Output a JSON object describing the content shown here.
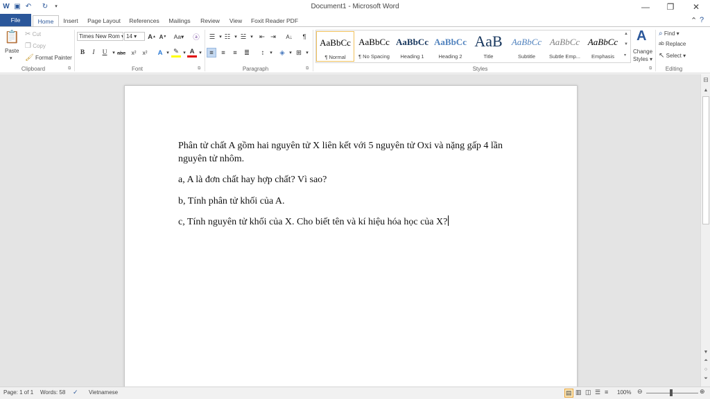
{
  "window": {
    "title": "Document1 - Microsoft Word",
    "minimize": "—",
    "restore": "❐",
    "close": "✕"
  },
  "tabs": [
    {
      "label": "File"
    },
    {
      "label": "Home"
    },
    {
      "label": "Insert"
    },
    {
      "label": "Page Layout"
    },
    {
      "label": "References"
    },
    {
      "label": "Mailings"
    },
    {
      "label": "Review"
    },
    {
      "label": "View"
    },
    {
      "label": "Foxit Reader PDF"
    }
  ],
  "clipboard": {
    "paste": "Paste",
    "cut": "Cut",
    "copy": "Copy",
    "format_painter": "Format Painter",
    "label": "Clipboard"
  },
  "font": {
    "name": "Times New Rom",
    "size": "14",
    "label": "Font"
  },
  "paragraph": {
    "label": "Paragraph"
  },
  "styles": {
    "label": "Styles",
    "items": [
      {
        "sample": "AaBbCc",
        "name": "¶ Normal"
      },
      {
        "sample": "AaBbCc",
        "name": "¶ No Spacing"
      },
      {
        "sample": "AaBbCc",
        "name": "Heading 1"
      },
      {
        "sample": "AaBbCc",
        "name": "Heading 2"
      },
      {
        "sample": "AaB",
        "name": "Title"
      },
      {
        "sample": "AaBbCc",
        "name": "Subtitle"
      },
      {
        "sample": "AaBbCc",
        "name": "Subtle Emp..."
      },
      {
        "sample": "AaBbCc",
        "name": "Emphasis"
      }
    ],
    "change_styles_line1": "Change",
    "change_styles_line2": "Styles"
  },
  "editing": {
    "find": "Find",
    "replace": "Replace",
    "select": "Select",
    "label": "Editing"
  },
  "document": {
    "paragraphs": [
      "Phân tử chất A gồm hai nguyên tử X liên kết với 5 nguyên tử Oxi và nặng gấp 4 lần nguyên tử nhôm.",
      "a, A là đơn chất hay hợp chất? Vì sao?",
      "b, Tính phân tử khối của A.",
      "c, Tính nguyên tử khối của X. Cho biết tên và kí hiệu hóa học của X?"
    ]
  },
  "status": {
    "page": "Page: 1 of 1",
    "words": "Words: 58",
    "language": "Vietnamese",
    "zoom": "100%"
  },
  "colors": {
    "accent": "#2b579a"
  }
}
